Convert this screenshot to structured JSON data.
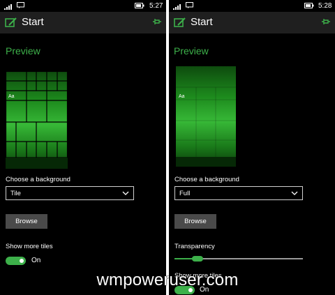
{
  "left": {
    "status": {
      "time": "5:27"
    },
    "header": {
      "title": "Start"
    },
    "section_title": "Preview",
    "preview": {
      "aa_label": "Aa"
    },
    "background": {
      "label": "Choose a background",
      "value": "Tile"
    },
    "browse_label": "Browse",
    "show_more_tiles": {
      "label": "Show more tiles",
      "state": "On"
    }
  },
  "right": {
    "status": {
      "time": "5:28"
    },
    "header": {
      "title": "Start"
    },
    "section_title": "Preview",
    "preview": {
      "aa_label": "Aa"
    },
    "background": {
      "label": "Choose a background",
      "value": "Full"
    },
    "browse_label": "Browse",
    "transparency": {
      "label": "Transparency",
      "level": 0.18
    },
    "show_more_tiles": {
      "label": "Show more tiles",
      "state": "On"
    }
  },
  "watermark": "wmpoweruser.com",
  "colors": {
    "accent": "#3db04a",
    "header_bg": "#1f1f1f",
    "button_bg": "#4a4a4a"
  }
}
